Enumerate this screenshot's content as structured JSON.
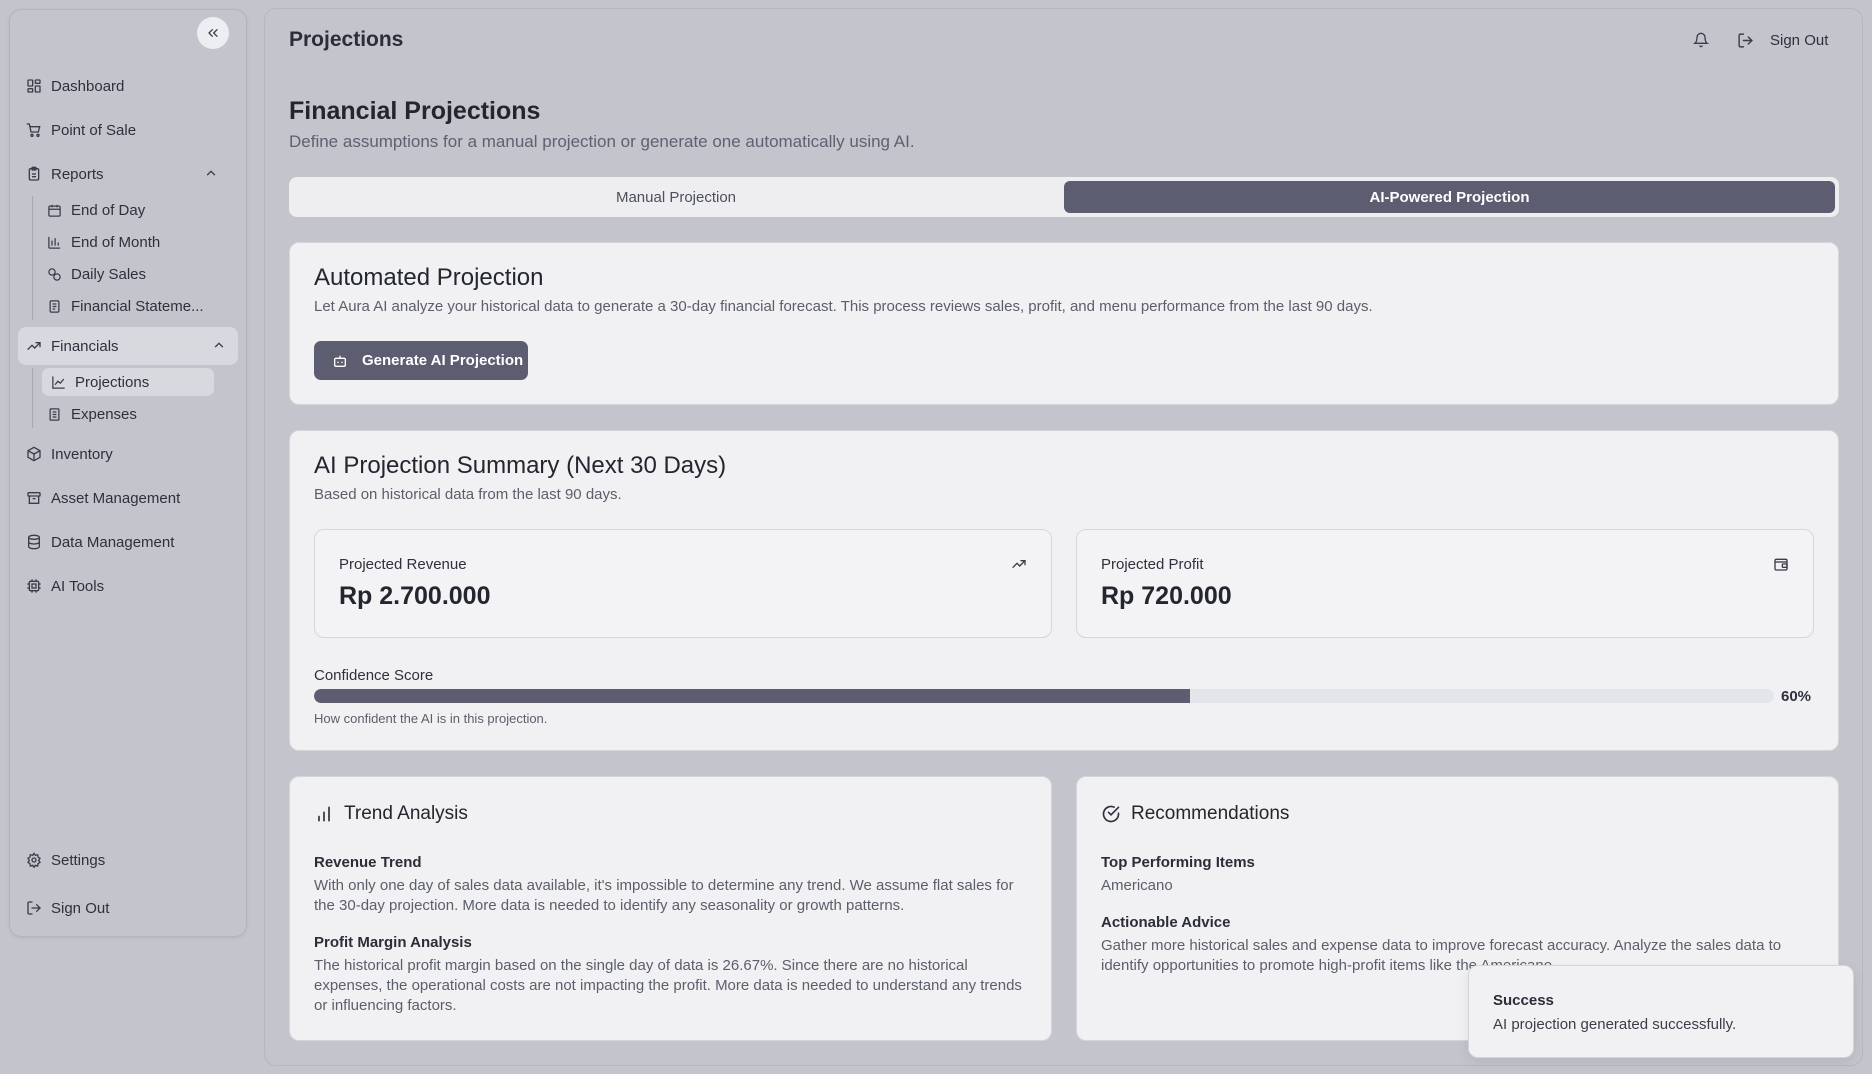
{
  "sidebar": {
    "items": [
      {
        "label": "Dashboard",
        "icon": "dashboard-icon"
      },
      {
        "label": "Point of Sale",
        "icon": "cart-icon"
      },
      {
        "label": "Reports",
        "icon": "report-icon"
      },
      {
        "label": "Financials",
        "icon": "trending-up-icon"
      },
      {
        "label": "Inventory",
        "icon": "package-icon"
      },
      {
        "label": "Asset Management",
        "icon": "archive-icon"
      },
      {
        "label": "Data Management",
        "icon": "database-icon"
      },
      {
        "label": "AI Tools",
        "icon": "cpu-icon"
      },
      {
        "label": "Settings",
        "icon": "gear-icon"
      },
      {
        "label": "Sign Out",
        "icon": "logout-icon"
      }
    ],
    "reports_sub": [
      {
        "label": "End of Day",
        "icon": "calendar-icon"
      },
      {
        "label": "End of Month",
        "icon": "bar-chart-icon"
      },
      {
        "label": "Daily Sales",
        "icon": "percent-icon"
      },
      {
        "label": "Financial Stateme...",
        "icon": "file-icon"
      }
    ],
    "financials_sub": [
      {
        "label": "Projections",
        "icon": "line-chart-icon"
      },
      {
        "label": "Expenses",
        "icon": "receipt-icon"
      }
    ]
  },
  "header": {
    "title": "Projections",
    "signout_label": "Sign Out"
  },
  "page": {
    "heading": "Financial Projections",
    "subheading": "Define assumptions for a manual projection or generate one automatically using AI."
  },
  "tabs": {
    "manual": "Manual Projection",
    "ai": "AI-Powered Projection",
    "active": "ai"
  },
  "automated": {
    "title": "Automated Projection",
    "description": "Let Aura AI analyze your historical data to generate a 30-day financial forecast. This process reviews sales, profit, and menu performance from the last 90 days.",
    "button": "Generate AI Projection"
  },
  "summary": {
    "title": "AI Projection Summary (Next 30 Days)",
    "subtitle": "Based on historical data from the last 90 days.",
    "revenue_label": "Projected Revenue",
    "revenue_value": "Rp 2.700.000",
    "profit_label": "Projected Profit",
    "profit_value": "Rp 720.000",
    "confidence_label": "Confidence Score",
    "confidence_value": 60,
    "confidence_text": "60%",
    "confidence_help": "How confident the AI is in this projection."
  },
  "trend": {
    "title": "Trend Analysis",
    "revenue_heading": "Revenue Trend",
    "revenue_text": "With only one day of sales data available, it's impossible to determine any trend. We assume flat sales for the 30-day projection. More data is needed to identify any seasonality or growth patterns.",
    "margin_heading": "Profit Margin Analysis",
    "margin_text": "The historical profit margin based on the single day of data is 26.67%. Since there are no historical expenses, the operational costs are not impacting the profit. More data is needed to understand any trends or influencing factors."
  },
  "recommendations": {
    "title": "Recommendations",
    "top_heading": "Top Performing Items",
    "top_items": "Americano",
    "advice_heading": "Actionable Advice",
    "advice_text": "Gather more historical sales and expense data to improve forecast accuracy. Analyze the sales data to identify opportunities to promote high-profit items like the Americano."
  },
  "toast": {
    "title": "Success",
    "message": "AI projection generated successfully."
  },
  "colors": {
    "accent": "#5c5d70",
    "background": "#c3c4cc",
    "card": "#f1f1f3"
  }
}
